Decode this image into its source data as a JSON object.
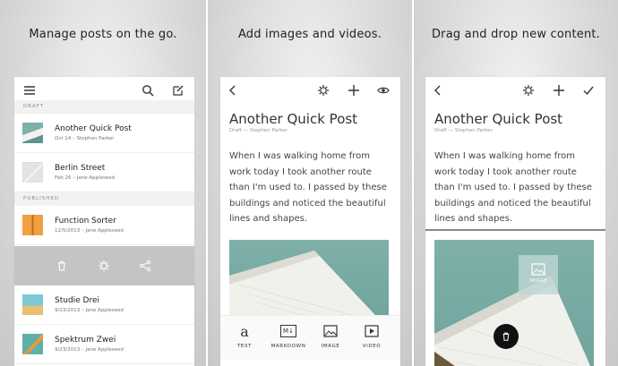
{
  "panels": [
    {
      "caption": "Manage posts on the go.",
      "sections": {
        "draft": "DRAFT",
        "published": "PUBLISHED"
      },
      "posts": [
        {
          "title": "Another Quick Post",
          "meta": "Oct 14 – Stephen Parker"
        },
        {
          "title": "Berlin Street",
          "meta": "Feb 26 – Jane Appleseed"
        },
        {
          "title": "Function Sorter",
          "meta": "12/5/2013 – Jane Appleseed"
        },
        {
          "title": "Studie Drei",
          "meta": "9/23/2013 – Jane Appleseed"
        },
        {
          "title": "Spektrum Zwei",
          "meta": "9/23/2013 – Jane Appleseed"
        }
      ]
    },
    {
      "caption": "Add images and videos.",
      "editor": {
        "title": "Another Quick Post",
        "meta": "Draft — Stephen Parker",
        "body": "When I was walking home from work today I took another route than I'm used to. I passed by these buildings and noticed the beautiful lines and shapes."
      },
      "tools": [
        {
          "label": "TEXT",
          "glyph": "a"
        },
        {
          "label": "MARKDOWN",
          "glyph": "M↓"
        },
        {
          "label": "IMAGE",
          "glyph": "image"
        },
        {
          "label": "VIDEO",
          "glyph": "video"
        }
      ]
    },
    {
      "caption": "Drag and drop new content.",
      "editor": {
        "title": "Another Quick Post",
        "meta": "Draft — Stephen Parker",
        "body": "When I was walking home from work today I took another route than I'm used to. I passed by these buildings and noticed the beautiful lines and shapes."
      },
      "drag_block_label": "IMAGE"
    }
  ],
  "colors": {
    "accent_orange": "#e08a2b",
    "photo_teal": "#74a8a1",
    "action_bar": "#c4c4c4"
  }
}
